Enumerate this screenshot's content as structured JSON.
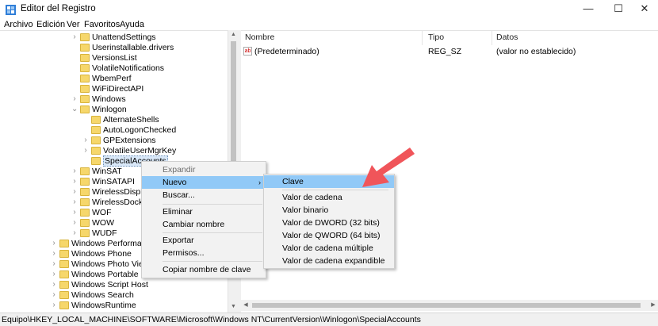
{
  "window": {
    "title": "Editor del Registro",
    "minimize": "—",
    "maximize": "☐",
    "close": "✕"
  },
  "menubar": [
    "Archivo",
    "Edición",
    "Ver",
    "Favoritos",
    "Ayuda"
  ],
  "tree": {
    "items": [
      {
        "label": "UnattendSettings",
        "depth": 1,
        "expanded": false,
        "has_children": true
      },
      {
        "label": "Userinstallable.drivers",
        "depth": 1,
        "expanded": false,
        "has_children": false
      },
      {
        "label": "VersionsList",
        "depth": 1,
        "expanded": false,
        "has_children": false
      },
      {
        "label": "VolatileNotifications",
        "depth": 1,
        "expanded": false,
        "has_children": false
      },
      {
        "label": "WbemPerf",
        "depth": 1,
        "expanded": false,
        "has_children": false
      },
      {
        "label": "WiFiDirectAPI",
        "depth": 1,
        "expanded": false,
        "has_children": false
      },
      {
        "label": "Windows",
        "depth": 1,
        "expanded": false,
        "has_children": true
      },
      {
        "label": "Winlogon",
        "depth": 1,
        "expanded": true,
        "has_children": true
      },
      {
        "label": "AlternateShells",
        "depth": 2,
        "expanded": false,
        "has_children": false
      },
      {
        "label": "AutoLogonChecked",
        "depth": 2,
        "expanded": false,
        "has_children": false
      },
      {
        "label": "GPExtensions",
        "depth": 2,
        "expanded": false,
        "has_children": true
      },
      {
        "label": "VolatileUserMgrKey",
        "depth": 2,
        "expanded": false,
        "has_children": true
      },
      {
        "label": "SpecialAccounts",
        "depth": 2,
        "expanded": false,
        "has_children": false,
        "selected": true
      },
      {
        "label": "WinSAT",
        "depth": 1,
        "expanded": false,
        "has_children": true
      },
      {
        "label": "WinSATAPI",
        "depth": 1,
        "expanded": false,
        "has_children": true
      },
      {
        "label": "WirelessDisplay",
        "depth": 1,
        "expanded": false,
        "has_children": true
      },
      {
        "label": "WirelessDocking",
        "depth": 1,
        "expanded": false,
        "has_children": true
      },
      {
        "label": "WOF",
        "depth": 1,
        "expanded": false,
        "has_children": true
      },
      {
        "label": "WOW",
        "depth": 1,
        "expanded": false,
        "has_children": true
      },
      {
        "label": "WUDF",
        "depth": 1,
        "expanded": false,
        "has_children": true
      },
      {
        "label": "Windows Performance T",
        "depth": 0,
        "expanded": false,
        "has_children": true
      },
      {
        "label": "Windows Phone",
        "depth": 0,
        "expanded": false,
        "has_children": true
      },
      {
        "label": "Windows Photo Viewer",
        "depth": 0,
        "expanded": false,
        "has_children": true
      },
      {
        "label": "Windows Portable Devic",
        "depth": 0,
        "expanded": false,
        "has_children": true
      },
      {
        "label": "Windows Script Host",
        "depth": 0,
        "expanded": false,
        "has_children": true
      },
      {
        "label": "Windows Search",
        "depth": 0,
        "expanded": false,
        "has_children": true
      },
      {
        "label": "WindowsRuntime",
        "depth": 0,
        "expanded": false,
        "has_children": true
      }
    ]
  },
  "list": {
    "columns": {
      "name": "Nombre",
      "type": "Tipo",
      "data": "Datos"
    },
    "rows": [
      {
        "name": "(Predeterminado)",
        "type": "REG_SZ",
        "data": "(valor no establecido)",
        "icon": "ab-string-icon"
      }
    ]
  },
  "context_menu": {
    "items": [
      {
        "label": "Expandir",
        "kind": "header"
      },
      {
        "label": "Nuevo",
        "kind": "submenu",
        "highlight": true
      },
      {
        "label": "Buscar...",
        "kind": "item"
      },
      {
        "label": "Eliminar",
        "kind": "item"
      },
      {
        "label": "Cambiar nombre",
        "kind": "item"
      },
      {
        "label": "Exportar",
        "kind": "item"
      },
      {
        "label": "Permisos...",
        "kind": "item"
      },
      {
        "label": "Copiar nombre de clave",
        "kind": "item"
      }
    ],
    "submenu_arrow": "›"
  },
  "submenu": {
    "items": [
      {
        "label": "Clave",
        "highlight": true
      },
      {
        "label": "Valor de cadena"
      },
      {
        "label": "Valor binario"
      },
      {
        "label": "Valor de DWORD (32 bits)"
      },
      {
        "label": "Valor de QWORD (64 bits)"
      },
      {
        "label": "Valor de cadena múltiple"
      },
      {
        "label": "Valor de cadena expandible"
      }
    ]
  },
  "statusbar": {
    "path": "Equipo\\HKEY_LOCAL_MACHINE\\SOFTWARE\\Microsoft\\Windows NT\\CurrentVersion\\Winlogon\\SpecialAccounts"
  },
  "colors": {
    "highlight": "#91c9f7",
    "pointer_arrow": "#f0555a",
    "folder": "#f6d76b"
  }
}
